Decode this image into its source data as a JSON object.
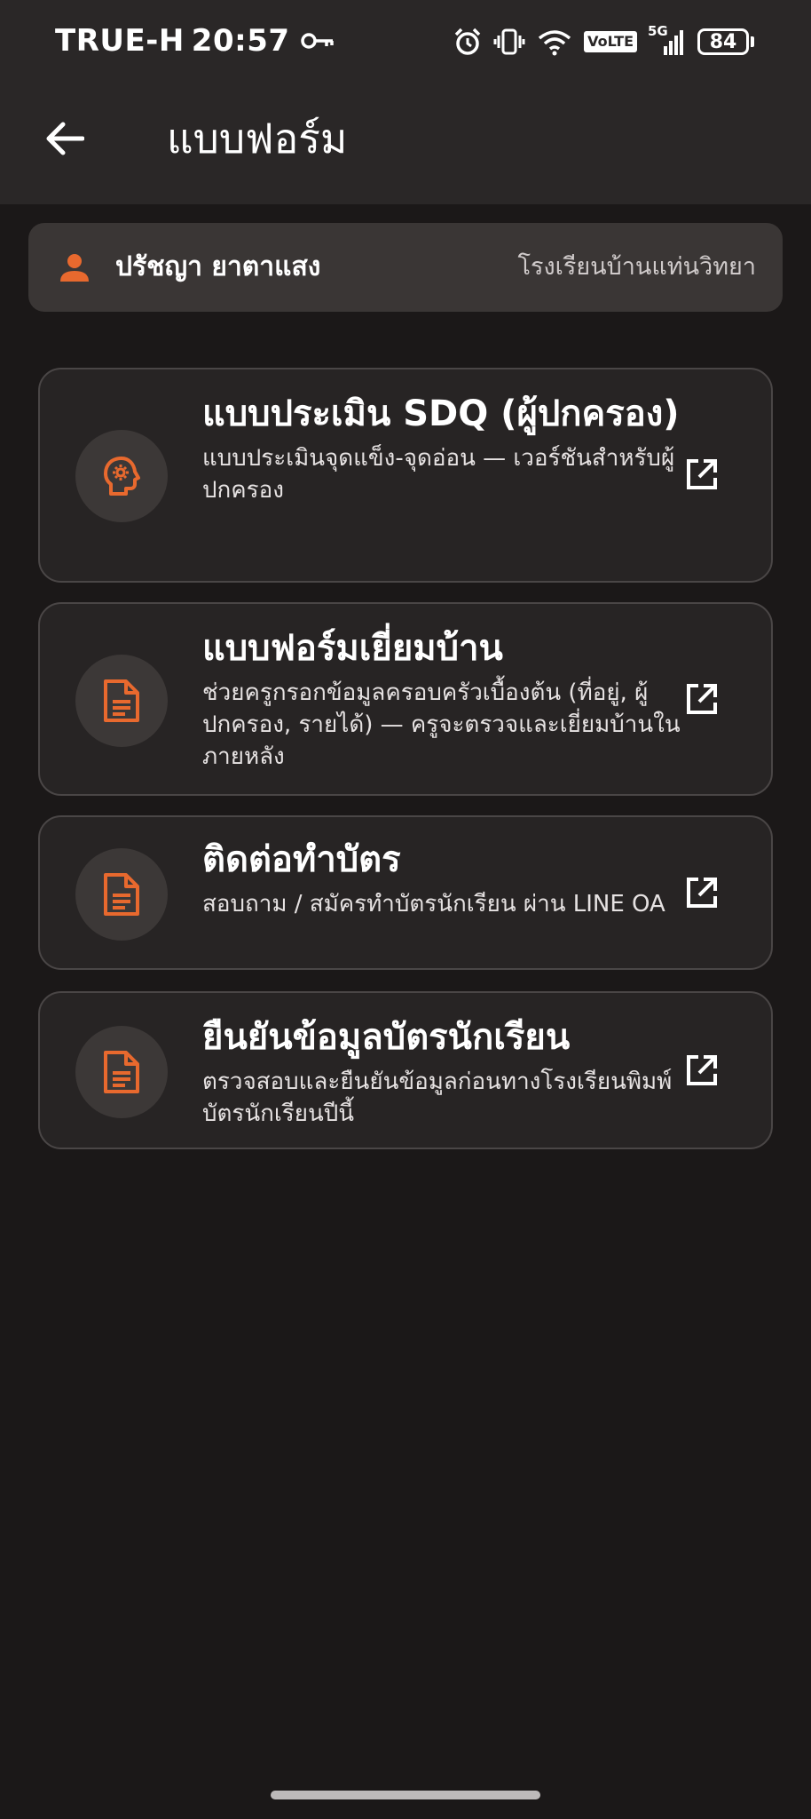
{
  "status_bar": {
    "carrier": "TRUE-H",
    "time": "20:57",
    "network": "5G",
    "volte": "VoLTE",
    "battery": "84"
  },
  "app_bar": {
    "title": "แบบฟอร์ม"
  },
  "user": {
    "name": "ปรัชญา ยาตาแสง",
    "school": "โรงเรียนบ้านแท่นวิทยา"
  },
  "colors": {
    "accent": "#e8692e",
    "background": "#1b1818",
    "card": "#272424"
  },
  "forms": [
    {
      "icon": "psychology-head-icon",
      "title": "แบบประเมิน SDQ (ผู้ปกครอง)",
      "description": "แบบประเมินจุดแข็ง-จุดอ่อน — เวอร์ชันสำหรับผู้ปกครอง"
    },
    {
      "icon": "document-icon",
      "title": "แบบฟอร์มเยี่ยมบ้าน",
      "description": "ช่วยครูกรอกข้อมูลครอบครัวเบื้องต้น (ที่อยู่, ผู้ปกครอง, รายได้) — ครูจะตรวจและเยี่ยมบ้านในภายหลัง"
    },
    {
      "icon": "document-icon",
      "title": "ติดต่อทำบัตร",
      "description": "สอบถาม / สมัครทำบัตรนักเรียน ผ่าน LINE OA"
    },
    {
      "icon": "document-icon",
      "title": "ยืนยันข้อมูลบัตรนักเรียน",
      "description": "ตรวจสอบและยืนยันข้อมูลก่อนทางโรงเรียนพิมพ์บัตรนักเรียนปีนี้"
    }
  ]
}
